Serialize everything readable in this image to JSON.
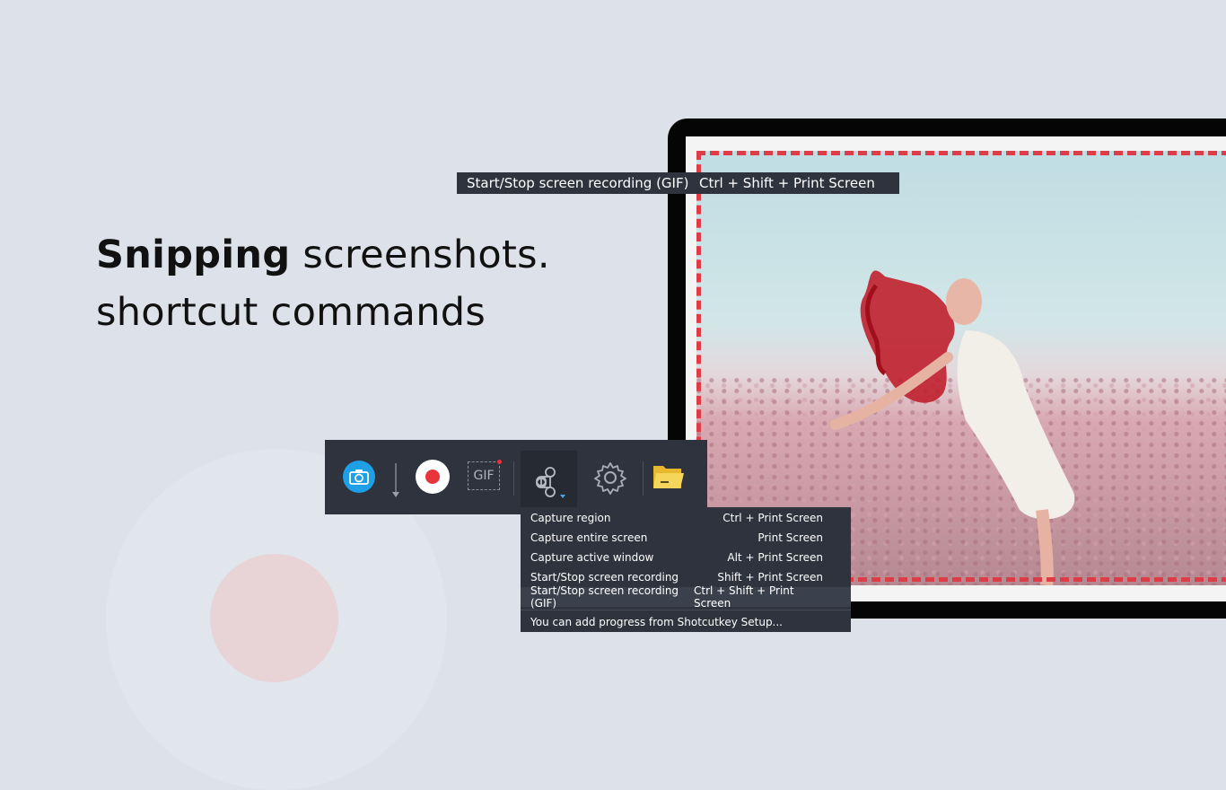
{
  "headline": {
    "bold": "Snipping",
    "rest": " screenshots.",
    "line2": "shortcut commands"
  },
  "tooltip": {
    "label": "Start/Stop screen recording (GIF)",
    "shortcut": "Ctrl + Shift + Print Screen"
  },
  "toolbar": {
    "buttons": [
      {
        "icon": "camera-icon"
      },
      {
        "icon": "arrow-down-icon"
      },
      {
        "icon": "record-icon"
      },
      {
        "icon": "gif-icon",
        "label": "GIF"
      },
      {
        "icon": "command-key-icon"
      },
      {
        "icon": "gear-icon"
      },
      {
        "icon": "folder-icon"
      }
    ]
  },
  "menu": {
    "items": [
      {
        "label": "Capture region",
        "shortcut": "Ctrl + Print Screen"
      },
      {
        "label": "Capture entire screen",
        "shortcut": "Print Screen"
      },
      {
        "label": "Capture active window",
        "shortcut": "Alt + Print Screen"
      },
      {
        "label": "Start/Stop screen recording",
        "shortcut": "Shift + Print Screen"
      },
      {
        "label": "Start/Stop screen recording (GIF)",
        "shortcut": "Ctrl + Shift + Print Screen",
        "selected": true
      }
    ],
    "footer": "You can add progress from Shotcutkey Setup..."
  },
  "colors": {
    "background": "#dde2ea",
    "toolbar": "#2e333d",
    "accent_blue": "#1e9fe6",
    "record_red": "#e8343a",
    "selection_dash": "#de3c46"
  }
}
